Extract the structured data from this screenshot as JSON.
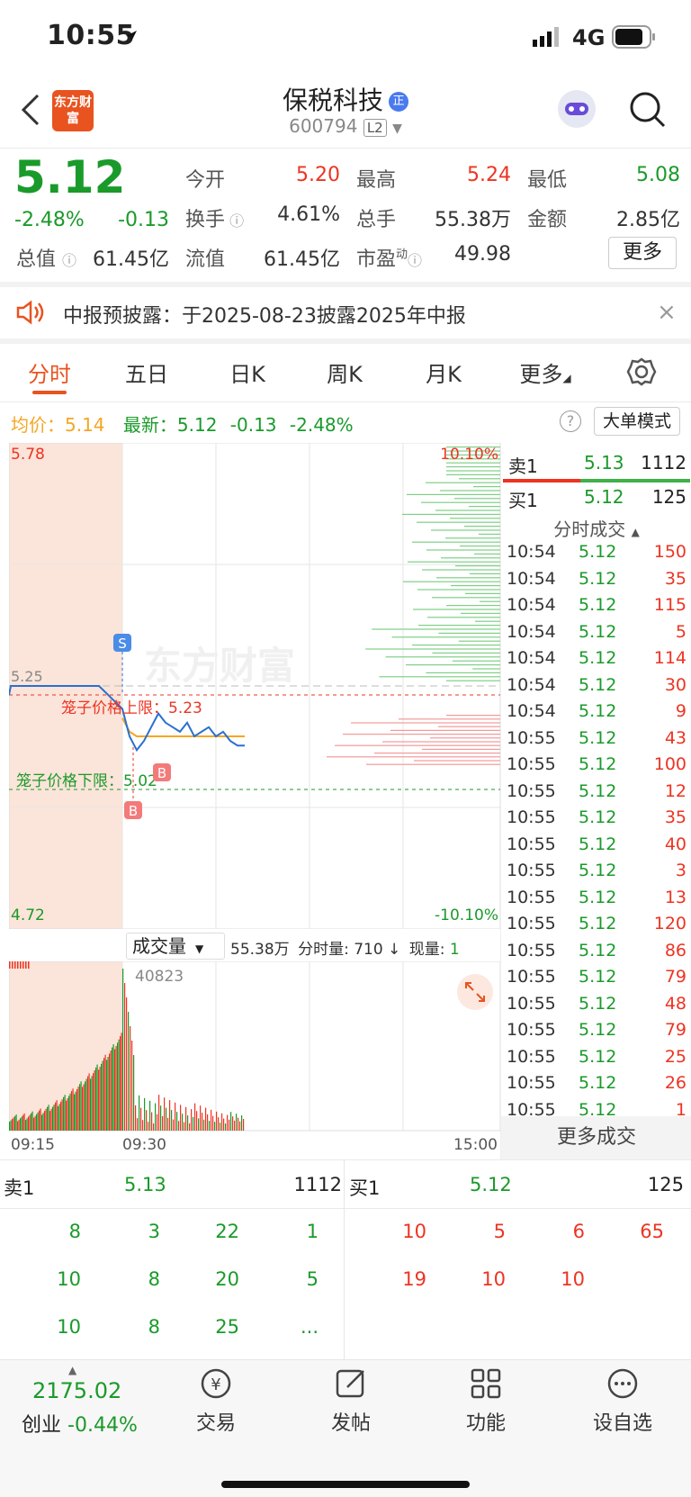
{
  "status_bar": {
    "time": "10:55",
    "network": "4G"
  },
  "header": {
    "stock_name": "保税科技",
    "stock_code": "600794",
    "logo_text": "东方财富",
    "badge": "正",
    "level_badge": "L2"
  },
  "quote": {
    "price": "5.12",
    "change_pct": "-2.48%",
    "change_abs": "-0.13",
    "labels": {
      "open": "今开",
      "high": "最高",
      "low": "最低",
      "turnover": "换手",
      "volume": "总手",
      "amount": "金额",
      "total_cap": "总值",
      "float_cap": "流值",
      "pe": "市盈",
      "pe_sup": "动"
    },
    "open": "5.20",
    "high": "5.24",
    "low": "5.08",
    "turnover": "4.61%",
    "volume": "55.38万",
    "amount": "2.85亿",
    "total_cap": "61.45亿",
    "float_cap": "61.45亿",
    "pe": "49.98",
    "more_button": "更多"
  },
  "notice": {
    "text": "中报预披露：于2025-08-23披露2025年中报"
  },
  "tabs": [
    "分时",
    "五日",
    "日K",
    "周K",
    "月K",
    "更多"
  ],
  "chart_header": {
    "avg_label": "均价：",
    "avg_value": "5.14",
    "latest_label": "最新：",
    "latest_value": "5.12",
    "change": "-0.13",
    "change_pct": "-2.48%",
    "big_order_mode": "大单模式"
  },
  "chart_labels": {
    "top_price": "5.78",
    "bottom_price": "4.72",
    "top_pct": "10.10%",
    "bottom_pct": "-10.10%",
    "prev_close": "5.25",
    "upper_limit": "笼子价格上限：5.23",
    "lower_limit": "笼子价格下限：5.02",
    "marker_s": "S",
    "marker_b": "B"
  },
  "volume_header": {
    "selector": "成交量",
    "total": "55.38万",
    "minute_vol": "分时量: 710 ↓",
    "current_label": "现量: ",
    "current": "1",
    "peak": "40823",
    "time_start": "09:15",
    "time_open": "09:30",
    "time_end": "15:00"
  },
  "chart_data": {
    "type": "line",
    "ylim": [
      4.72,
      5.78
    ],
    "x": [
      "09:30",
      "09:35",
      "09:40",
      "09:45",
      "09:50",
      "09:55",
      "10:00",
      "10:05",
      "10:10",
      "10:15",
      "10:20",
      "10:25",
      "10:30",
      "10:35",
      "10:40",
      "10:45",
      "10:50",
      "10:55"
    ],
    "series": [
      {
        "name": "均价",
        "values": [
          5.18,
          5.15,
          5.14,
          5.14,
          5.14,
          5.14,
          5.14,
          5.14,
          5.14,
          5.14,
          5.14,
          5.14,
          5.14,
          5.14,
          5.14,
          5.14,
          5.14,
          5.14
        ]
      },
      {
        "name": "最新",
        "values": [
          5.2,
          5.14,
          5.11,
          5.13,
          5.16,
          5.19,
          5.17,
          5.16,
          5.15,
          5.17,
          5.14,
          5.15,
          5.16,
          5.14,
          5.15,
          5.13,
          5.12,
          5.12
        ]
      }
    ]
  },
  "order_book_right": {
    "sell1_label": "卖1",
    "sell1_price": "5.13",
    "sell1_qty": "1112",
    "buy1_label": "买1",
    "buy1_price": "5.12",
    "buy1_qty": "125",
    "ticks_title": "分时成交",
    "ticks": [
      {
        "time": "10:54",
        "price": "5.12",
        "vol": "150"
      },
      {
        "time": "10:54",
        "price": "5.12",
        "vol": "35"
      },
      {
        "time": "10:54",
        "price": "5.12",
        "vol": "115"
      },
      {
        "time": "10:54",
        "price": "5.12",
        "vol": "5"
      },
      {
        "time": "10:54",
        "price": "5.12",
        "vol": "114"
      },
      {
        "time": "10:54",
        "price": "5.12",
        "vol": "30"
      },
      {
        "time": "10:54",
        "price": "5.12",
        "vol": "9"
      },
      {
        "time": "10:55",
        "price": "5.12",
        "vol": "43"
      },
      {
        "time": "10:55",
        "price": "5.12",
        "vol": "100"
      },
      {
        "time": "10:55",
        "price": "5.12",
        "vol": "12"
      },
      {
        "time": "10:55",
        "price": "5.12",
        "vol": "35"
      },
      {
        "time": "10:55",
        "price": "5.12",
        "vol": "40"
      },
      {
        "time": "10:55",
        "price": "5.12",
        "vol": "3"
      },
      {
        "time": "10:55",
        "price": "5.12",
        "vol": "13"
      },
      {
        "time": "10:55",
        "price": "5.12",
        "vol": "120"
      },
      {
        "time": "10:55",
        "price": "5.12",
        "vol": "86"
      },
      {
        "time": "10:55",
        "price": "5.12",
        "vol": "79"
      },
      {
        "time": "10:55",
        "price": "5.12",
        "vol": "48"
      },
      {
        "time": "10:55",
        "price": "5.12",
        "vol": "79"
      },
      {
        "time": "10:55",
        "price": "5.12",
        "vol": "25"
      },
      {
        "time": "10:55",
        "price": "5.12",
        "vol": "26"
      },
      {
        "time": "10:55",
        "price": "5.12",
        "vol": "1"
      }
    ],
    "more_ticks": "更多成交"
  },
  "queue": {
    "sell_label": "卖1",
    "sell_price": "5.13",
    "sell_qty": "1112",
    "buy_label": "买1",
    "buy_price": "5.12",
    "buy_qty": "125",
    "sell_rows": [
      [
        "8",
        "3",
        "22",
        "1"
      ],
      [
        "10",
        "8",
        "20",
        "5"
      ],
      [
        "10",
        "8",
        "25",
        "..."
      ]
    ],
    "buy_rows": [
      [
        "10",
        "5",
        "6",
        "65"
      ],
      [
        "19",
        "10",
        "10",
        ""
      ]
    ]
  },
  "bottom_nav": {
    "index_value": "2175.02",
    "index_name": "创业",
    "index_change": "-0.44%",
    "items": [
      "交易",
      "发帖",
      "功能",
      "设自选"
    ]
  }
}
